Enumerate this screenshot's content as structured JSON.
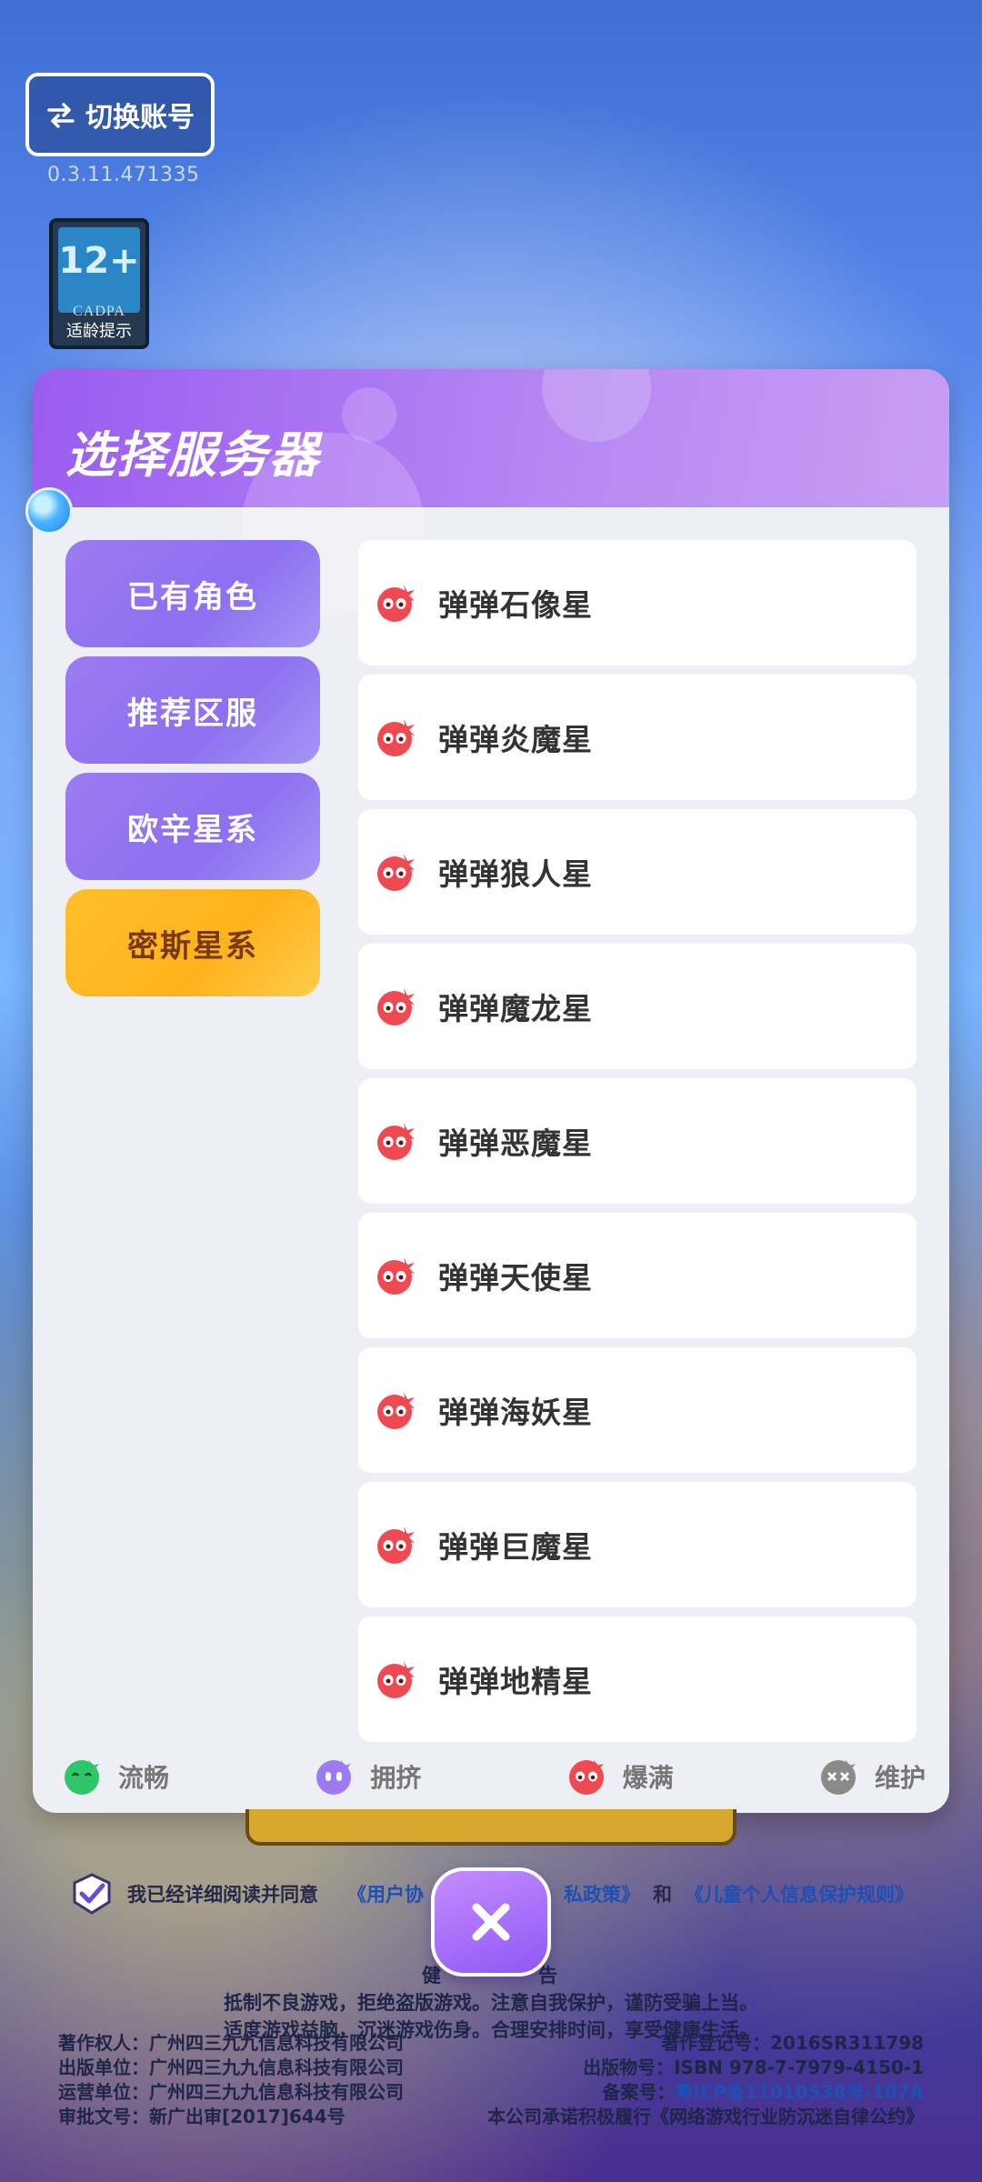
{
  "top": {
    "switch_account_label": "切换账号",
    "version": "0.3.11.471335",
    "age_rating": {
      "number": "12+",
      "org": "CADPA",
      "tip": "适龄提示"
    }
  },
  "dialog": {
    "title": "选择服务器",
    "tabs": [
      {
        "label": "已有角色",
        "active": false
      },
      {
        "label": "推荐区服",
        "active": false
      },
      {
        "label": "欧辛星系",
        "active": false
      },
      {
        "label": "密斯星系",
        "active": true
      }
    ],
    "servers": [
      {
        "name": "弹弹石像星",
        "status": "爆满"
      },
      {
        "name": "弹弹炎魔星",
        "status": "爆满"
      },
      {
        "name": "弹弹狼人星",
        "status": "爆满"
      },
      {
        "name": "弹弹魔龙星",
        "status": "爆满"
      },
      {
        "name": "弹弹恶魔星",
        "status": "爆满"
      },
      {
        "name": "弹弹天使星",
        "status": "爆满"
      },
      {
        "name": "弹弹海妖星",
        "status": "爆满"
      },
      {
        "name": "弹弹巨魔星",
        "status": "爆满"
      },
      {
        "name": "弹弹地精星",
        "status": "爆满"
      }
    ],
    "legend": [
      {
        "label": "流畅",
        "color": "#2fc56b",
        "icon": "smooth-status-icon"
      },
      {
        "label": "拥挤",
        "color": "#9c7bf2",
        "icon": "crowded-status-icon"
      },
      {
        "label": "爆满",
        "color": "#ef4a52",
        "icon": "full-status-icon"
      },
      {
        "label": "维护",
        "color": "#8a8a8a",
        "icon": "maintenance-status-icon"
      }
    ]
  },
  "agreement": {
    "prefix": "我已经详细阅读并同意",
    "user_agreement": "《用户协",
    "privacy_policy": "私政策》",
    "and": "和",
    "child_rules": "《儿童个人信息保护规则》"
  },
  "health_notice": {
    "title_left": "健",
    "title_right": "告",
    "line1": "抵制不良游戏，拒绝盗版游戏。注意自我保护，谨防受骗上当。",
    "line2": "适度游戏益脑，沉迷游戏伤身。合理安排时间，享受健康生活。"
  },
  "footer": {
    "copyright_owner": "著作权人：广州四三九九信息科技有限公司",
    "copyright_reg": "著作登记号：2016SR311798",
    "publisher": "出版单位：广州四三九九信息科技有限公司",
    "publication_no": "出版物号：ISBN 978-7-7979-4150-1",
    "operator": "运营单位：广州四三九九信息科技有限公司",
    "record_label": "备案号：",
    "record_no": "粤ICP备11010538号-107A",
    "approval": "审批文号：新广出审[2017]644号",
    "commitment": "本公司承诺积极履行《网络游戏行业防沉迷自律公约》"
  },
  "colors": {
    "header_purple": "#9a5cf0",
    "tab_purple": "#9b7bf0",
    "tab_active_yellow": "#ffbf2a",
    "full_red": "#ef4a52"
  }
}
